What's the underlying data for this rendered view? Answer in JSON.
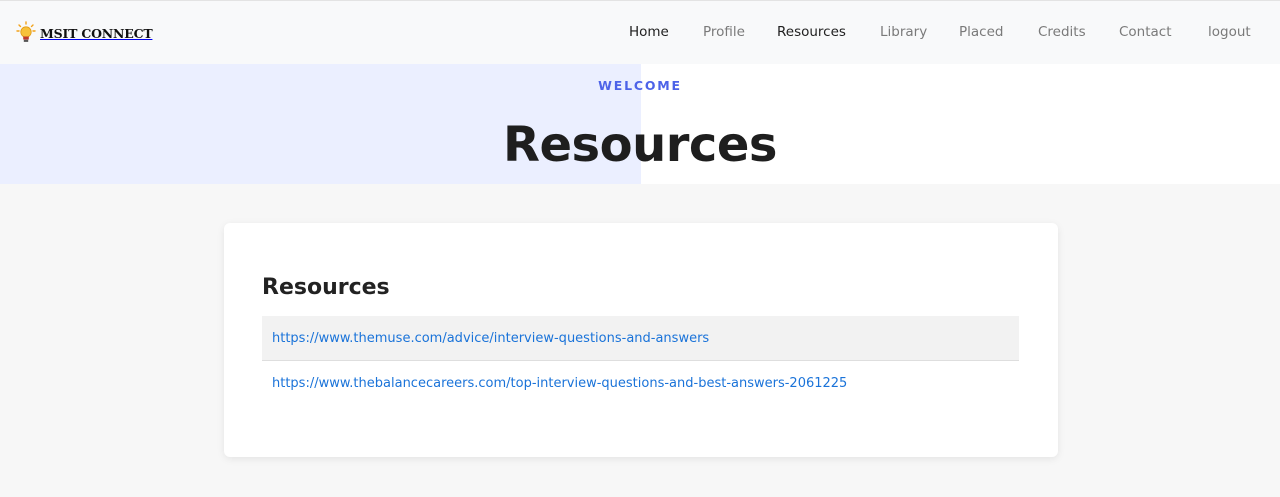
{
  "nav": {
    "brand": "MSIT CONNECT",
    "brand_icon": "lightbulb-icon",
    "links": [
      {
        "label": "Home",
        "active": true
      },
      {
        "label": "Profile",
        "active": false
      },
      {
        "label": "Resources",
        "active": true
      },
      {
        "label": "Library",
        "active": false
      },
      {
        "label": "Placed",
        "active": false
      },
      {
        "label": "Credits",
        "active": false
      },
      {
        "label": "Contact",
        "active": false
      },
      {
        "label": "logout",
        "active": false
      }
    ]
  },
  "hero": {
    "eyebrow": "WELCOME",
    "title": "Resources"
  },
  "content": {
    "title": "Resources",
    "links": [
      "https://www.themuse.com/advice/interview-questions-and-answers",
      "https://www.thebalancecareers.com/top-interview-questions-and-best-answers-2061225"
    ]
  },
  "colors": {
    "accent": "#4d63e8",
    "link": "#1a73d9",
    "hero_left": "#ebefff",
    "navbar": "#f8f9fa"
  }
}
